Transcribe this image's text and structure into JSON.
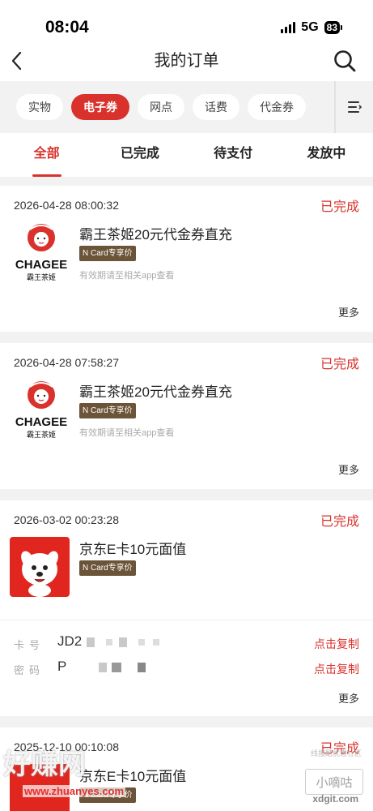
{
  "status_bar": {
    "time": "08:04",
    "network": "5G",
    "battery": "83"
  },
  "navbar": {
    "title": "我的订单"
  },
  "categories": [
    {
      "label": "实物",
      "active": false
    },
    {
      "label": "电子券",
      "active": true
    },
    {
      "label": "网点",
      "active": false
    },
    {
      "label": "话费",
      "active": false
    },
    {
      "label": "代金券",
      "active": false
    }
  ],
  "tabs": [
    {
      "label": "全部",
      "active": true
    },
    {
      "label": "已完成",
      "active": false
    },
    {
      "label": "待支付",
      "active": false
    },
    {
      "label": "发放中",
      "active": false
    }
  ],
  "orders": [
    {
      "date": "2026-04-28 08:00:32",
      "status": "已完成",
      "name": "霸王茶姬20元代金券直充",
      "tag": "N Card专享价",
      "hint": "有效期请至相关app查看",
      "more": "更多",
      "logo_text": "CHAGEE",
      "logo_sub": "霸王茶姬"
    },
    {
      "date": "2026-04-28 07:58:27",
      "status": "已完成",
      "name": "霸王茶姬20元代金券直充",
      "tag": "N Card专享价",
      "hint": "有效期请至相关app查看",
      "more": "更多",
      "logo_text": "CHAGEE",
      "logo_sub": "霸王茶姬"
    },
    {
      "date": "2026-03-02 00:23:28",
      "status": "已完成",
      "name": "京东E卡10元面值",
      "tag": "N Card专享价",
      "card_label": "卡号",
      "card_value": "JD2",
      "pwd_label": "密码",
      "pwd_value": "P",
      "copy_label": "点击复制",
      "more": "更多"
    },
    {
      "date": "2025-12-10 00:10:08",
      "status": "已完成",
      "name": "京东E卡10元面值",
      "tag": "N Card专享价"
    }
  ],
  "watermark": {
    "main": "好赚网",
    "url": "www.zhuanyes.com",
    "site_badge": "小嘀咕",
    "site_url": "xdgit.com",
    "site_small": "线报酷优惠社区"
  },
  "colors": {
    "accent": "#d9322c",
    "tag_bg": "#6b5438",
    "bg": "#f2f2f2"
  }
}
